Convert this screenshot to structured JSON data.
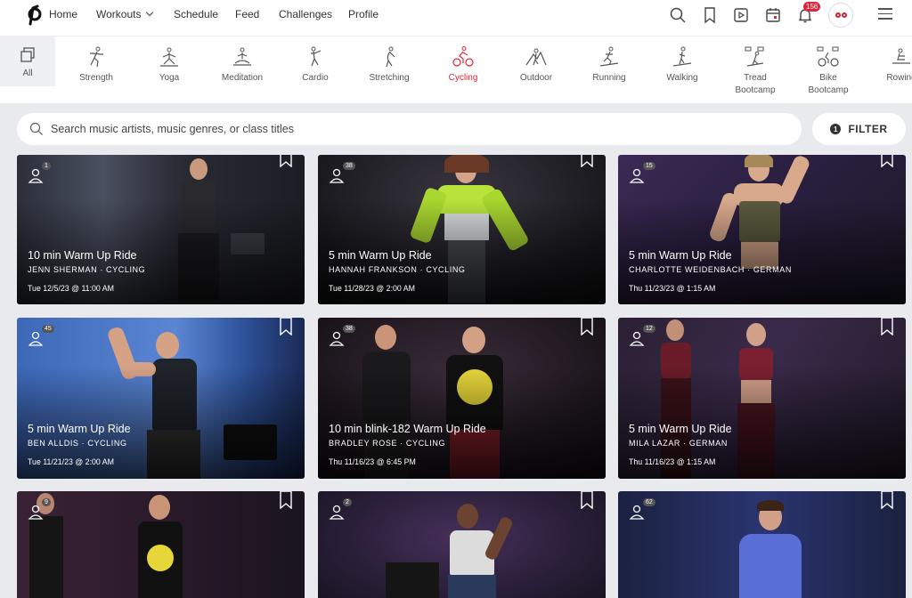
{
  "nav": {
    "links": [
      "Home",
      "Workouts",
      "Schedule",
      "Feed",
      "Challenges",
      "Profile"
    ],
    "notification_count": "156"
  },
  "categories": [
    {
      "label": "All",
      "icon": "grid-icon"
    },
    {
      "label": "Strength",
      "icon": "strength-icon"
    },
    {
      "label": "Yoga",
      "icon": "yoga-icon"
    },
    {
      "label": "Meditation",
      "icon": "meditation-icon"
    },
    {
      "label": "Cardio",
      "icon": "cardio-icon"
    },
    {
      "label": "Stretching",
      "icon": "stretching-icon"
    },
    {
      "label": "Cycling",
      "icon": "cycling-icon",
      "active": true
    },
    {
      "label": "Outdoor",
      "icon": "outdoor-icon"
    },
    {
      "label": "Running",
      "icon": "running-icon"
    },
    {
      "label": "Walking",
      "icon": "walking-icon"
    },
    {
      "label": "Tread",
      "label2": "Bootcamp",
      "icon": "tread-bootcamp-icon"
    },
    {
      "label": "Bike",
      "label2": "Bootcamp",
      "icon": "bike-bootcamp-icon"
    },
    {
      "label": "Rowing",
      "icon": "rowing-icon"
    }
  ],
  "search": {
    "placeholder": "Search music artists, music genres, or class titles"
  },
  "filter": {
    "label": "FILTER",
    "badge": "1"
  },
  "classes": [
    {
      "count": "1",
      "title": "10 min Warm Up Ride",
      "instructor": "JENN SHERMAN",
      "tag": "CYCLING",
      "date": "Tue 12/5/23 @ 11:00 AM"
    },
    {
      "count": "38",
      "title": "5 min Warm Up Ride",
      "instructor": "HANNAH FRANKSON",
      "tag": "CYCLING",
      "date": "Tue 11/28/23 @ 2:00 AM"
    },
    {
      "count": "15",
      "title": "5 min Warm Up Ride",
      "instructor": "CHARLOTTE WEIDENBACH",
      "tag": "GERMAN",
      "date": "Thu 11/23/23 @ 1:15 AM"
    },
    {
      "count": "45",
      "title": "5 min Warm Up Ride",
      "instructor": "BEN ALLDIS",
      "tag": "CYCLING",
      "date": "Tue 11/21/23 @ 2:00 AM"
    },
    {
      "count": "38",
      "title": "10 min blink-182 Warm Up Ride",
      "instructor": "BRADLEY ROSE",
      "tag": "CYCLING",
      "date": "Thu 11/16/23 @ 6:45 PM"
    },
    {
      "count": "12",
      "title": "5 min Warm Up Ride",
      "instructor": "MILA LAZAR",
      "tag": "GERMAN",
      "date": "Thu 11/16/23 @ 1:15 AM"
    },
    {
      "count": "9",
      "title": "",
      "instructor": "",
      "tag": "",
      "date": ""
    },
    {
      "count": "2",
      "title": "",
      "instructor": "",
      "tag": "",
      "date": ""
    },
    {
      "count": "62",
      "title": "",
      "instructor": "",
      "tag": "",
      "date": ""
    }
  ],
  "colors": {
    "accent": "#e0263a",
    "background": "#e9eaee"
  }
}
